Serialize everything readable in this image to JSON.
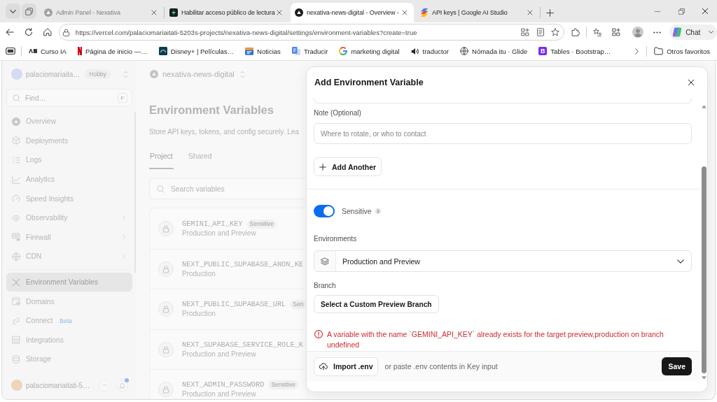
{
  "browser": {
    "tabs": [
      {
        "title": "Admin Panel - Nexativa",
        "kind": "triangle-circle",
        "dimmed": true,
        "selected": false
      },
      {
        "title": "Habilitar acceso público de lectura",
        "kind": "bolt-tile",
        "dimmed": false,
        "selected": false
      },
      {
        "title": "nexativa-news-digital - Overview -",
        "kind": "triangle-circle",
        "dimmed": false,
        "selected": true
      },
      {
        "title": "API keys | Google AI Studio",
        "kind": "stripes-tile",
        "dimmed": false,
        "selected": false
      }
    ],
    "address_bar": {
      "url": "https://vercel.com/palaciomariaitati-5203s-projects/nexativa-news-digital/settings/environment-variables?create=true"
    },
    "chat_button": {
      "label": "Chat"
    },
    "bookmarks": [
      {
        "label": "Curso IA",
        "kind": "ia-mark"
      },
      {
        "label": "Página de inicio —…",
        "kind": "n-mark"
      },
      {
        "label": "Disney+ | Películas…",
        "kind": "dark-tile"
      },
      {
        "label": "Noticias",
        "kind": "news"
      },
      {
        "label": "Traducir",
        "kind": "translate"
      },
      {
        "label": "marketing digital",
        "kind": "g-ring"
      },
      {
        "label": "traductor",
        "kind": "speaker"
      },
      {
        "label": "Nómada itu · Glide",
        "kind": "globe-b"
      },
      {
        "label": "Tables · Bootstrap…",
        "kind": "letter-tile",
        "letter": "B"
      }
    ],
    "other_favorites": {
      "label": "Otros favoritos"
    }
  },
  "page": {
    "sidebar": {
      "team": {
        "name": "palaciomariaita…",
        "plan": "Hobby"
      },
      "search": {
        "placeholder": "Find…",
        "shortcut": "F"
      },
      "nav_sections": [
        {
          "items": [
            {
              "label": "Overview",
              "kind": "triangle",
              "selected": false,
              "has_submenu": false
            },
            {
              "label": "Deployments",
              "kind": "cube",
              "selected": false,
              "has_submenu": false
            },
            {
              "label": "Logs",
              "kind": "list",
              "selected": false,
              "has_submenu": false
            },
            {
              "label": "Analytics",
              "kind": "chart",
              "selected": false,
              "has_submenu": false
            },
            {
              "label": "Speed Insights",
              "kind": "gauge",
              "selected": false,
              "has_submenu": false
            },
            {
              "label": "Observability",
              "kind": "eye",
              "selected": false,
              "has_submenu": true
            },
            {
              "label": "Firewall",
              "kind": "bricks",
              "selected": false,
              "has_submenu": true
            },
            {
              "label": "CDN",
              "kind": "globe",
              "selected": false,
              "has_submenu": true
            }
          ]
        },
        {
          "items": [
            {
              "label": "Environment Variables",
              "kind": "variable",
              "selected": true,
              "has_submenu": false
            },
            {
              "label": "Domains",
              "kind": "domain",
              "selected": false,
              "has_submenu": false
            },
            {
              "label": "Connect",
              "kind": "link",
              "badge": "Beta",
              "selected": false,
              "has_submenu": false
            },
            {
              "label": "Integrations",
              "kind": "store",
              "selected": false,
              "has_submenu": false
            },
            {
              "label": "Storage",
              "kind": "database",
              "selected": false,
              "has_submenu": false
            }
          ]
        }
      ],
      "user": {
        "name": "palaciomariaitati-5…",
        "unread_notifications": true
      }
    },
    "project": {
      "name": "nexativa-news-digital"
    },
    "title": "Environment Variables",
    "description": "Store API keys, tokens, and config securely. Lea",
    "tabs": [
      {
        "label": "Project",
        "selected": true
      },
      {
        "label": "Shared",
        "selected": false
      }
    ],
    "search": {
      "placeholder": "Search variables"
    },
    "variables": [
      {
        "name": "GEMINI_API_KEY",
        "badge": "Sensitive",
        "environments": "Production and Preview"
      },
      {
        "name": "NEXT_PUBLIC_SUPABASE_ANON_KE",
        "environments": "Production"
      },
      {
        "name": "NEXT_PUBLIC_SUPABASE_URL",
        "badge": "Sen",
        "environments": "Production"
      },
      {
        "name": "NEXT_SUPABASE_SERVICE_ROLE_K",
        "environments": "Production and Preview"
      },
      {
        "name": "NEXT_ADMIN_PASSWORD",
        "badge": "Sensitive",
        "environments": "Production and Preview"
      }
    ]
  },
  "dialog": {
    "title": "Add Environment Variable",
    "note": {
      "label": "Note (Optional)",
      "placeholder": "Where to rotate, or who to contact"
    },
    "add_another": {
      "label": "Add Another"
    },
    "sensitive": {
      "label": "Sensitive",
      "on": true
    },
    "environments": {
      "label": "Environments",
      "value": "Production and Preview"
    },
    "branch": {
      "label": "Branch",
      "button": "Select a Custom Preview Branch"
    },
    "error": "A variable with the name `GEMINI_API_KEY` already exists for the target preview,production on branch undefined",
    "footer": {
      "import_button": "Import .env",
      "hint": "or paste .env contents in Key input",
      "save_button": "Save"
    }
  }
}
